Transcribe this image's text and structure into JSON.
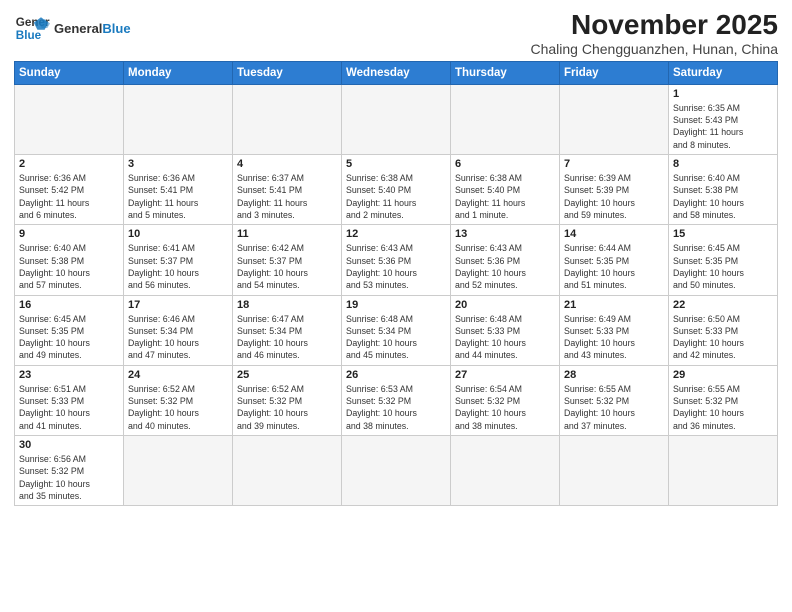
{
  "logo": {
    "line1": "General",
    "line2": "Blue"
  },
  "title": "November 2025",
  "subtitle": "Chaling Chengguanzhen, Hunan, China",
  "days_of_week": [
    "Sunday",
    "Monday",
    "Tuesday",
    "Wednesday",
    "Thursday",
    "Friday",
    "Saturday"
  ],
  "weeks": [
    [
      {
        "day": "",
        "info": ""
      },
      {
        "day": "",
        "info": ""
      },
      {
        "day": "",
        "info": ""
      },
      {
        "day": "",
        "info": ""
      },
      {
        "day": "",
        "info": ""
      },
      {
        "day": "",
        "info": ""
      },
      {
        "day": "1",
        "info": "Sunrise: 6:35 AM\nSunset: 5:43 PM\nDaylight: 11 hours\nand 8 minutes."
      }
    ],
    [
      {
        "day": "2",
        "info": "Sunrise: 6:36 AM\nSunset: 5:42 PM\nDaylight: 11 hours\nand 6 minutes."
      },
      {
        "day": "3",
        "info": "Sunrise: 6:36 AM\nSunset: 5:41 PM\nDaylight: 11 hours\nand 5 minutes."
      },
      {
        "day": "4",
        "info": "Sunrise: 6:37 AM\nSunset: 5:41 PM\nDaylight: 11 hours\nand 3 minutes."
      },
      {
        "day": "5",
        "info": "Sunrise: 6:38 AM\nSunset: 5:40 PM\nDaylight: 11 hours\nand 2 minutes."
      },
      {
        "day": "6",
        "info": "Sunrise: 6:38 AM\nSunset: 5:40 PM\nDaylight: 11 hours\nand 1 minute."
      },
      {
        "day": "7",
        "info": "Sunrise: 6:39 AM\nSunset: 5:39 PM\nDaylight: 10 hours\nand 59 minutes."
      },
      {
        "day": "8",
        "info": "Sunrise: 6:40 AM\nSunset: 5:38 PM\nDaylight: 10 hours\nand 58 minutes."
      }
    ],
    [
      {
        "day": "9",
        "info": "Sunrise: 6:40 AM\nSunset: 5:38 PM\nDaylight: 10 hours\nand 57 minutes."
      },
      {
        "day": "10",
        "info": "Sunrise: 6:41 AM\nSunset: 5:37 PM\nDaylight: 10 hours\nand 56 minutes."
      },
      {
        "day": "11",
        "info": "Sunrise: 6:42 AM\nSunset: 5:37 PM\nDaylight: 10 hours\nand 54 minutes."
      },
      {
        "day": "12",
        "info": "Sunrise: 6:43 AM\nSunset: 5:36 PM\nDaylight: 10 hours\nand 53 minutes."
      },
      {
        "day": "13",
        "info": "Sunrise: 6:43 AM\nSunset: 5:36 PM\nDaylight: 10 hours\nand 52 minutes."
      },
      {
        "day": "14",
        "info": "Sunrise: 6:44 AM\nSunset: 5:35 PM\nDaylight: 10 hours\nand 51 minutes."
      },
      {
        "day": "15",
        "info": "Sunrise: 6:45 AM\nSunset: 5:35 PM\nDaylight: 10 hours\nand 50 minutes."
      }
    ],
    [
      {
        "day": "16",
        "info": "Sunrise: 6:45 AM\nSunset: 5:35 PM\nDaylight: 10 hours\nand 49 minutes."
      },
      {
        "day": "17",
        "info": "Sunrise: 6:46 AM\nSunset: 5:34 PM\nDaylight: 10 hours\nand 47 minutes."
      },
      {
        "day": "18",
        "info": "Sunrise: 6:47 AM\nSunset: 5:34 PM\nDaylight: 10 hours\nand 46 minutes."
      },
      {
        "day": "19",
        "info": "Sunrise: 6:48 AM\nSunset: 5:34 PM\nDaylight: 10 hours\nand 45 minutes."
      },
      {
        "day": "20",
        "info": "Sunrise: 6:48 AM\nSunset: 5:33 PM\nDaylight: 10 hours\nand 44 minutes."
      },
      {
        "day": "21",
        "info": "Sunrise: 6:49 AM\nSunset: 5:33 PM\nDaylight: 10 hours\nand 43 minutes."
      },
      {
        "day": "22",
        "info": "Sunrise: 6:50 AM\nSunset: 5:33 PM\nDaylight: 10 hours\nand 42 minutes."
      }
    ],
    [
      {
        "day": "23",
        "info": "Sunrise: 6:51 AM\nSunset: 5:33 PM\nDaylight: 10 hours\nand 41 minutes."
      },
      {
        "day": "24",
        "info": "Sunrise: 6:52 AM\nSunset: 5:32 PM\nDaylight: 10 hours\nand 40 minutes."
      },
      {
        "day": "25",
        "info": "Sunrise: 6:52 AM\nSunset: 5:32 PM\nDaylight: 10 hours\nand 39 minutes."
      },
      {
        "day": "26",
        "info": "Sunrise: 6:53 AM\nSunset: 5:32 PM\nDaylight: 10 hours\nand 38 minutes."
      },
      {
        "day": "27",
        "info": "Sunrise: 6:54 AM\nSunset: 5:32 PM\nDaylight: 10 hours\nand 38 minutes."
      },
      {
        "day": "28",
        "info": "Sunrise: 6:55 AM\nSunset: 5:32 PM\nDaylight: 10 hours\nand 37 minutes."
      },
      {
        "day": "29",
        "info": "Sunrise: 6:55 AM\nSunset: 5:32 PM\nDaylight: 10 hours\nand 36 minutes."
      }
    ],
    [
      {
        "day": "30",
        "info": "Sunrise: 6:56 AM\nSunset: 5:32 PM\nDaylight: 10 hours\nand 35 minutes."
      },
      {
        "day": "",
        "info": ""
      },
      {
        "day": "",
        "info": ""
      },
      {
        "day": "",
        "info": ""
      },
      {
        "day": "",
        "info": ""
      },
      {
        "day": "",
        "info": ""
      },
      {
        "day": "",
        "info": ""
      }
    ]
  ]
}
